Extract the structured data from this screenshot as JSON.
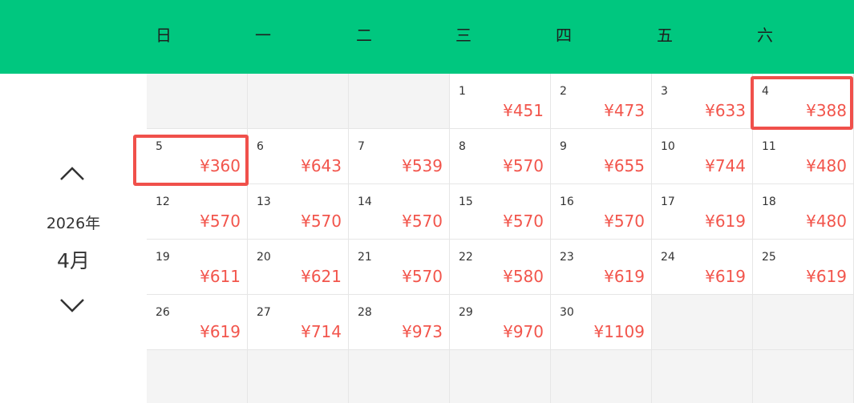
{
  "header": {
    "weekdays": [
      "日",
      "一",
      "二",
      "三",
      "四",
      "五",
      "六"
    ]
  },
  "nav": {
    "prev_icon": "chevron-up-icon",
    "next_icon": "chevron-down-icon",
    "year": "2026年",
    "month": "4月"
  },
  "colors": {
    "header_bg": "#00c77f",
    "price": "#f2554c",
    "highlight": "#f0504b",
    "empty_cell": "#f4f4f4"
  },
  "calendar": {
    "weeks": [
      [
        null,
        null,
        null,
        {
          "day": "1",
          "price": "¥451"
        },
        {
          "day": "2",
          "price": "¥473"
        },
        {
          "day": "3",
          "price": "¥633"
        },
        {
          "day": "4",
          "price": "¥388"
        }
      ],
      [
        {
          "day": "5",
          "price": "¥360"
        },
        {
          "day": "6",
          "price": "¥643"
        },
        {
          "day": "7",
          "price": "¥539"
        },
        {
          "day": "8",
          "price": "¥570"
        },
        {
          "day": "9",
          "price": "¥655"
        },
        {
          "day": "10",
          "price": "¥744"
        },
        {
          "day": "11",
          "price": "¥480"
        }
      ],
      [
        {
          "day": "12",
          "price": "¥570"
        },
        {
          "day": "13",
          "price": "¥570"
        },
        {
          "day": "14",
          "price": "¥570"
        },
        {
          "day": "15",
          "price": "¥570"
        },
        {
          "day": "16",
          "price": "¥570"
        },
        {
          "day": "17",
          "price": "¥619"
        },
        {
          "day": "18",
          "price": "¥480"
        }
      ],
      [
        {
          "day": "19",
          "price": "¥611"
        },
        {
          "day": "20",
          "price": "¥621"
        },
        {
          "day": "21",
          "price": "¥570"
        },
        {
          "day": "22",
          "price": "¥580"
        },
        {
          "day": "23",
          "price": "¥619"
        },
        {
          "day": "24",
          "price": "¥619"
        },
        {
          "day": "25",
          "price": "¥619"
        }
      ],
      [
        {
          "day": "26",
          "price": "¥619"
        },
        {
          "day": "27",
          "price": "¥714"
        },
        {
          "day": "28",
          "price": "¥973"
        },
        {
          "day": "29",
          "price": "¥970"
        },
        {
          "day": "30",
          "price": "¥1109"
        },
        null,
        null
      ],
      [
        null,
        null,
        null,
        null,
        null,
        null,
        null
      ]
    ],
    "highlighted_days": [
      "4",
      "5"
    ]
  }
}
